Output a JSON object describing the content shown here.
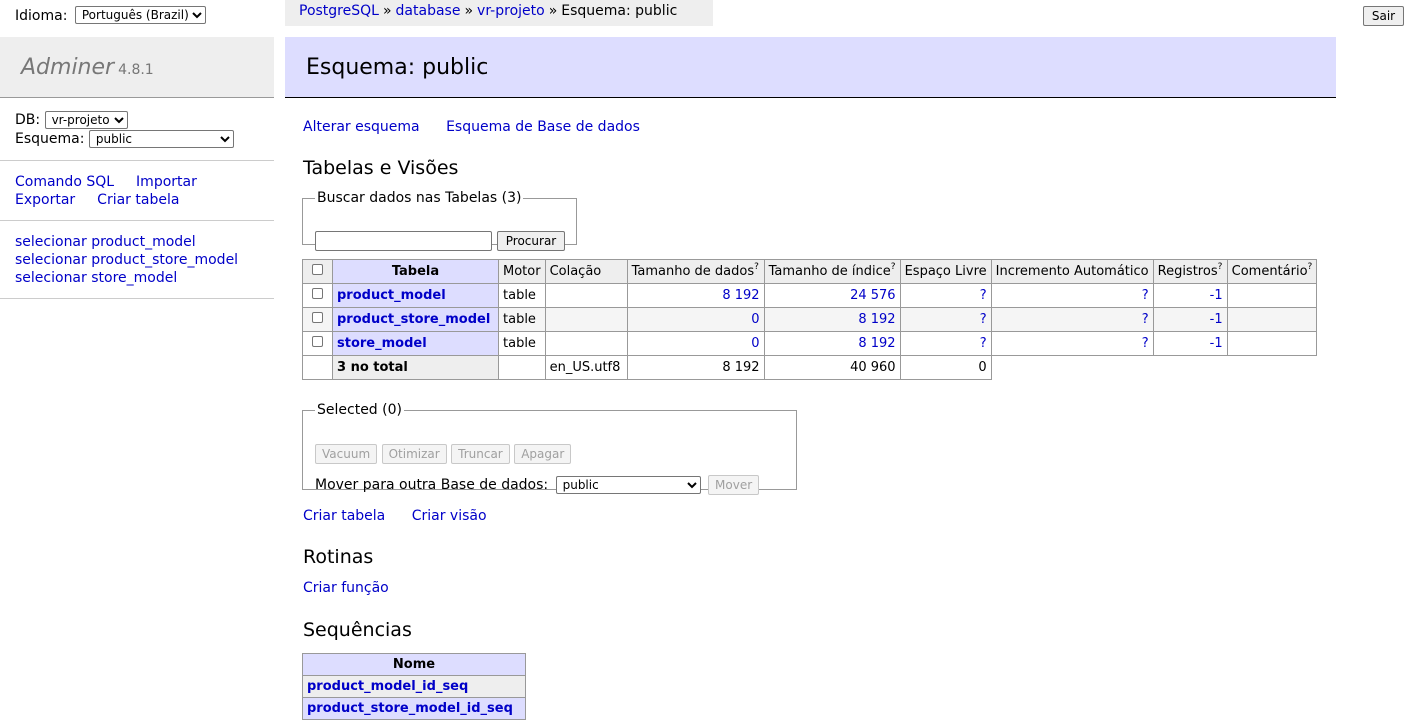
{
  "lang": {
    "label": "Idioma:",
    "selected": "Português (Brazil)"
  },
  "logout_label": "Sair",
  "breadcrumb": {
    "items": [
      "PostgreSQL",
      "database",
      "vr-projeto"
    ],
    "current": "Esquema: public"
  },
  "sidebar": {
    "brand": "Adminer",
    "version": "4.8.1",
    "db_label": "DB:",
    "db_selected": "vr-projeto",
    "schema_label": "Esquema:",
    "schema_selected": "public",
    "commands": [
      "Comando SQL",
      "Importar",
      "Exportar",
      "Criar tabela"
    ],
    "table_links": [
      "selecionar product_model",
      "selecionar product_store_model",
      "selecionar store_model"
    ]
  },
  "main": {
    "title": "Esquema: public",
    "links": [
      "Alterar esquema",
      "Esquema de Base de dados"
    ],
    "tables_heading": "Tabelas e Visões",
    "search": {
      "legend": "Buscar dados nas Tabelas (3)",
      "value": "",
      "button": "Procurar"
    },
    "table": {
      "headers": [
        "Tabela",
        "Motor",
        "Colação",
        "Tamanho de dados",
        "Tamanho de índice",
        "Espaço Livre",
        "Incremento Automático",
        "Registros",
        "Comentário"
      ],
      "help_mark": "?",
      "rows": [
        {
          "name": "product_model",
          "engine": "table",
          "collation": "",
          "data": "8 192",
          "index": "24 576",
          "free": "?",
          "auto": "?",
          "rows": "-1",
          "comment": ""
        },
        {
          "name": "product_store_model",
          "engine": "table",
          "collation": "",
          "data": "0",
          "index": "8 192",
          "free": "?",
          "auto": "?",
          "rows": "-1",
          "comment": ""
        },
        {
          "name": "store_model",
          "engine": "table",
          "collation": "",
          "data": "0",
          "index": "8 192",
          "free": "?",
          "auto": "?",
          "rows": "-1",
          "comment": ""
        }
      ],
      "total": {
        "label": "3 no total",
        "engine": "",
        "collation": "en_US.utf8",
        "data": "8 192",
        "index": "40 960",
        "free": "0"
      }
    },
    "selected": {
      "legend": "Selected (0)",
      "buttons": [
        "Vacuum",
        "Otimizar",
        "Truncar",
        "Apagar"
      ],
      "move_label": "Mover para outra Base de dados:",
      "move_selected": "public",
      "move_button": "Mover"
    },
    "create_links": [
      "Criar tabela",
      "Criar visão"
    ],
    "routines_heading": "Rotinas",
    "create_function": "Criar função",
    "sequences_heading": "Sequências",
    "sequences": {
      "header": "Nome",
      "items": [
        "product_model_id_seq",
        "product_store_model_id_seq"
      ]
    }
  }
}
